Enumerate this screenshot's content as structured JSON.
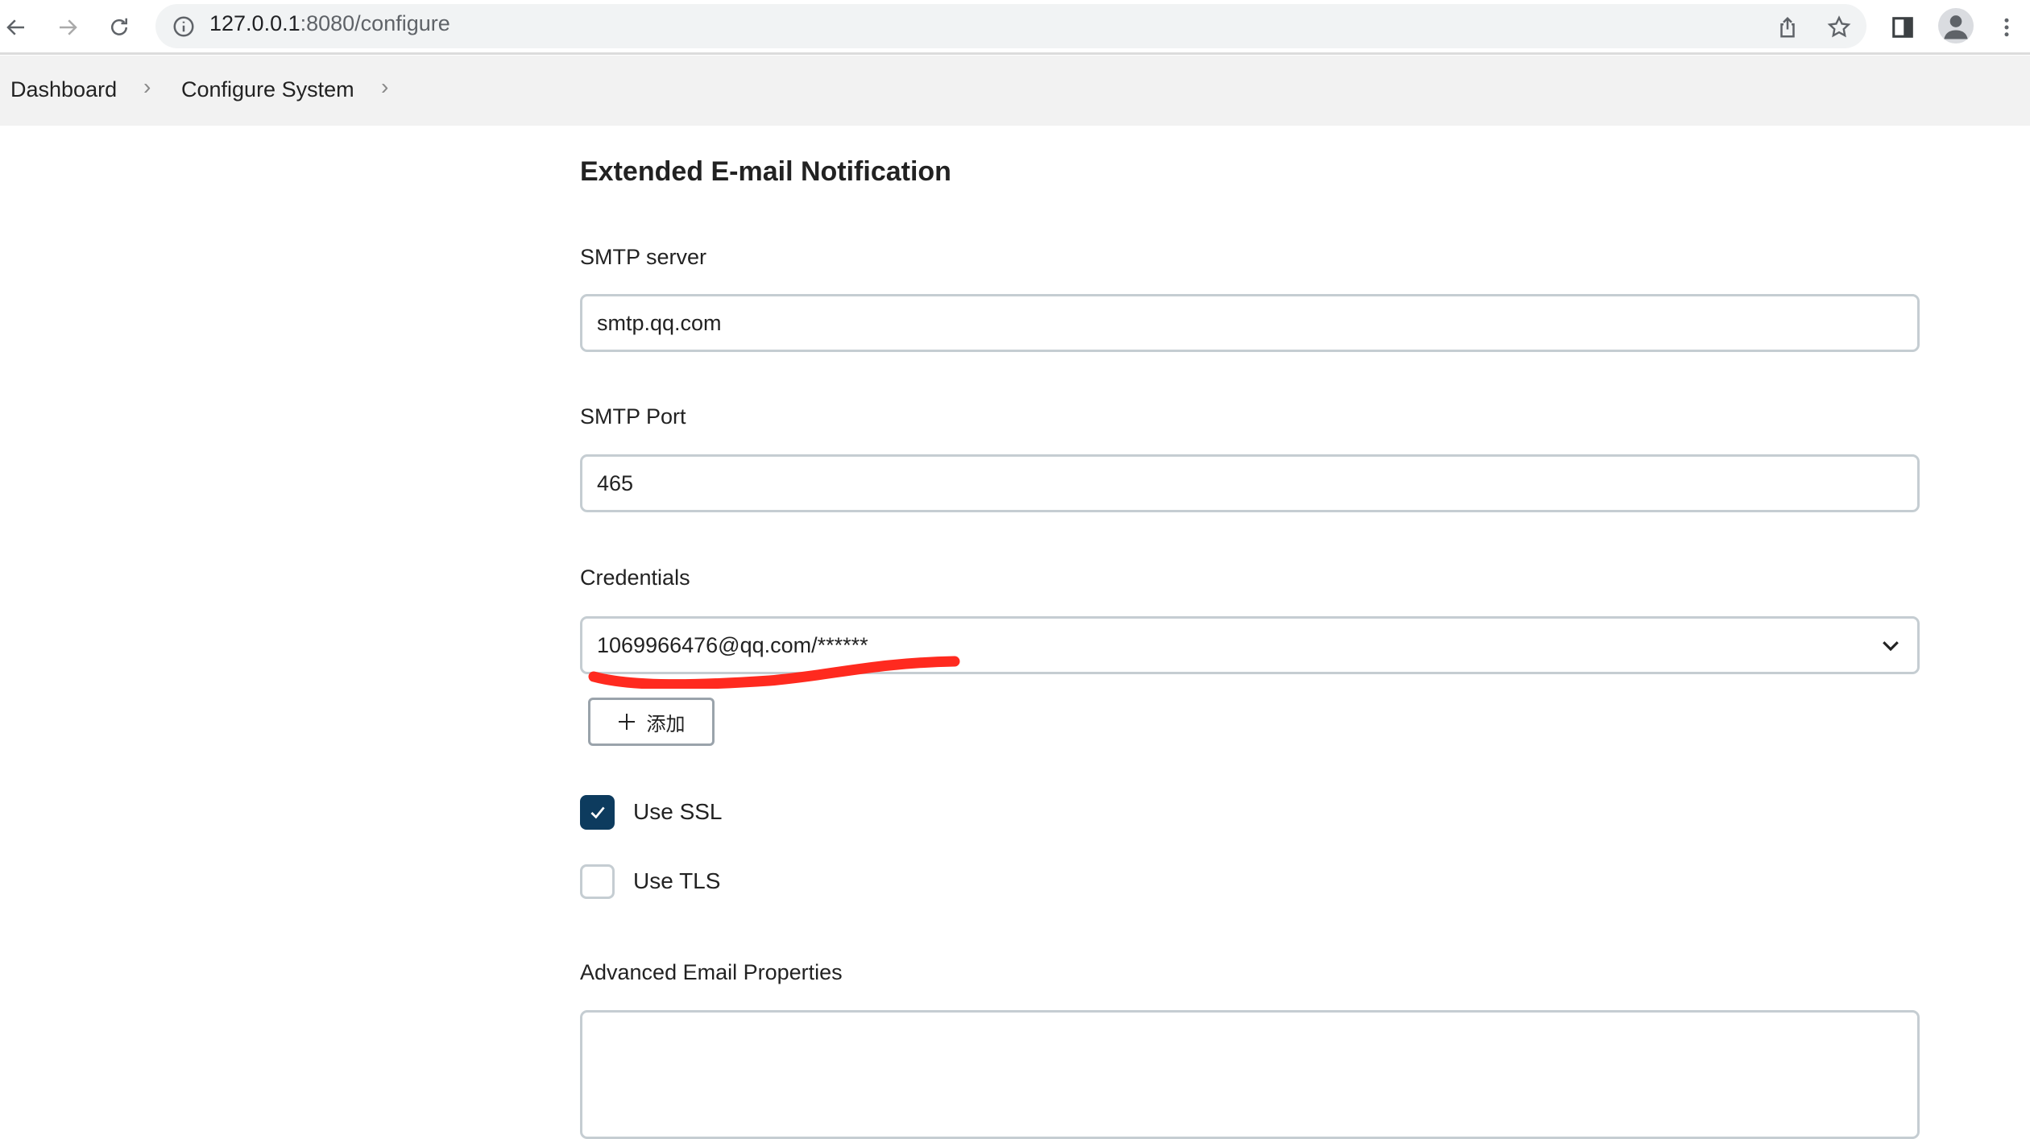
{
  "browser": {
    "url_host": "127.0.0.1",
    "url_rest": ":8080/configure",
    "icons": [
      "back-icon",
      "forward-icon",
      "reload-icon",
      "info-icon",
      "share-icon",
      "star-icon",
      "side-panel-icon",
      "profile-icon",
      "menu-icon"
    ]
  },
  "breadcrumb": {
    "items": [
      "Dashboard",
      "Configure System"
    ]
  },
  "section": {
    "title": "Extended E-mail Notification",
    "smtp_server_label": "SMTP server",
    "smtp_server_value": "smtp.qq.com",
    "smtp_port_label": "SMTP Port",
    "smtp_port_value": "465",
    "credentials_label": "Credentials",
    "credentials_value": "1069966476@qq.com/******",
    "add_button_label": "添加",
    "use_ssl_label": "Use SSL",
    "use_ssl_checked": true,
    "use_tls_label": "Use TLS",
    "use_tls_checked": false,
    "advanced_label": "Advanced Email Properties",
    "advanced_value": ""
  },
  "colors": {
    "checkbox_checked": "#0d3b5e",
    "annotation_red": "#ff2a1f"
  }
}
